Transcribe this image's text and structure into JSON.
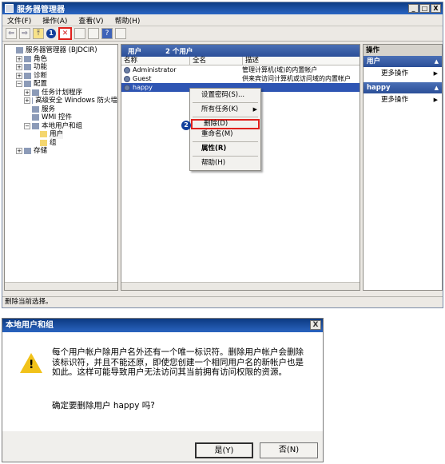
{
  "window": {
    "title": "服务器管理器",
    "controls": [
      "_",
      "□",
      "X"
    ]
  },
  "menu": [
    "文件(F)",
    "操作(A)",
    "查看(V)",
    "帮助(H)"
  ],
  "toolbar": {
    "back": "⇦",
    "forward": "⇨",
    "up": "⤒",
    "badge1": "1",
    "delete": "✕",
    "help": "?"
  },
  "tree": [
    {
      "label": "服务器管理器 (BJDCIR)",
      "indent": 0,
      "exp": ""
    },
    {
      "label": "角色",
      "indent": 1,
      "exp": "+"
    },
    {
      "label": "功能",
      "indent": 1,
      "exp": "+"
    },
    {
      "label": "诊断",
      "indent": 1,
      "exp": "+"
    },
    {
      "label": "配置",
      "indent": 1,
      "exp": "−"
    },
    {
      "label": "任务计划程序",
      "indent": 2,
      "exp": "+"
    },
    {
      "label": "高级安全 Windows 防火墙",
      "indent": 2,
      "exp": "+"
    },
    {
      "label": "服务",
      "indent": 2,
      "exp": ""
    },
    {
      "label": "WMI 控件",
      "indent": 2,
      "exp": ""
    },
    {
      "label": "本地用户和组",
      "indent": 2,
      "exp": "−"
    },
    {
      "label": "用户",
      "indent": 3,
      "exp": "",
      "selected": true
    },
    {
      "label": "组",
      "indent": 3,
      "exp": ""
    },
    {
      "label": "存储",
      "indent": 1,
      "exp": "+"
    }
  ],
  "middle": {
    "header": "用户",
    "count": "2 个用户",
    "columns": [
      "名称",
      "全名",
      "描述"
    ],
    "rows": [
      {
        "name": "Administrator",
        "fullname": "",
        "desc": "管理计算机(域)的内置帐户"
      },
      {
        "name": "Guest",
        "fullname": "",
        "desc": "供来宾访问计算机或访问域的内置帐户"
      },
      {
        "name": "happy",
        "fullname": "",
        "desc": "",
        "selected": true
      }
    ]
  },
  "context_menu": {
    "set_password": "设置密码(S)...",
    "all_tasks": "所有任务(K)",
    "delete": "删除(D)",
    "rename": "重命名(M)",
    "properties": "属性(R)",
    "help": "帮助(H)",
    "badge2": "2"
  },
  "actions": {
    "title": "操作",
    "sections": [
      {
        "header": "用户",
        "item": "更多操作"
      },
      {
        "header": "happy",
        "item": "更多操作"
      }
    ]
  },
  "status": "删除当前选择。",
  "dialog": {
    "title": "本地用户和组",
    "close": "X",
    "message": "每个用户帐户除用户名外还有一个唯一标识符。删除用户帐户会删除该标识符，并且不能还原，即使您创建一个相同用户名的新帐户也是如此。这样可能导致用户无法访问其当前拥有访问权限的资源。",
    "question": "确定要删除用户 happy 吗?",
    "yes": "是(Y)",
    "no": "否(N)"
  }
}
